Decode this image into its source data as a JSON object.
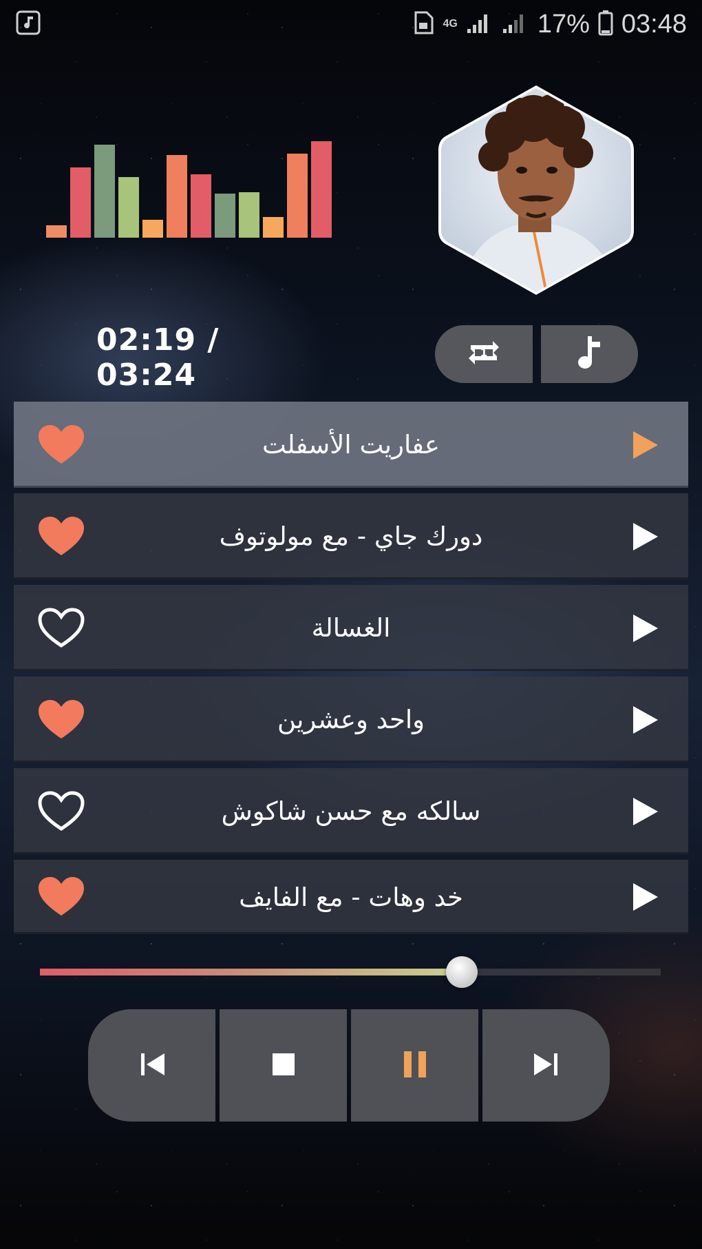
{
  "status_bar": {
    "left_icon": "music-notification-icon",
    "cast_icon": "cast-icon",
    "network": "4G",
    "battery": "17%",
    "time": "03:48"
  },
  "now_playing": {
    "equalizer_icon": "equalizer-icon",
    "elapsed_time": "02:19",
    "total_time": "03:24",
    "time_display": "02:19 / 03:24",
    "progress": 0.68
  },
  "mode_buttons": [
    {
      "name": "repeat-one-icon"
    },
    {
      "name": "music-note-icon"
    }
  ],
  "tracks": [
    {
      "title": "عفاريت الأسفلت",
      "favorite": true,
      "active": true
    },
    {
      "title": "دورك جاي - مع مولوتوف",
      "favorite": true,
      "active": false
    },
    {
      "title": "الغسالة",
      "favorite": false,
      "active": false
    },
    {
      "title": "واحد وعشرين",
      "favorite": true,
      "active": false
    },
    {
      "title": "سالكه مع حسن شاكوش",
      "favorite": false,
      "active": false
    },
    {
      "title": "خد وهات - مع الفايف",
      "favorite": true,
      "active": false
    }
  ],
  "controls": [
    {
      "name": "previous-icon"
    },
    {
      "name": "stop-icon"
    },
    {
      "name": "pause-icon"
    },
    {
      "name": "next-icon"
    }
  ],
  "colors": {
    "accent": "#f0a25a",
    "heart": "#f17b5c",
    "active_row": "#6e7380",
    "row": "#343842"
  }
}
